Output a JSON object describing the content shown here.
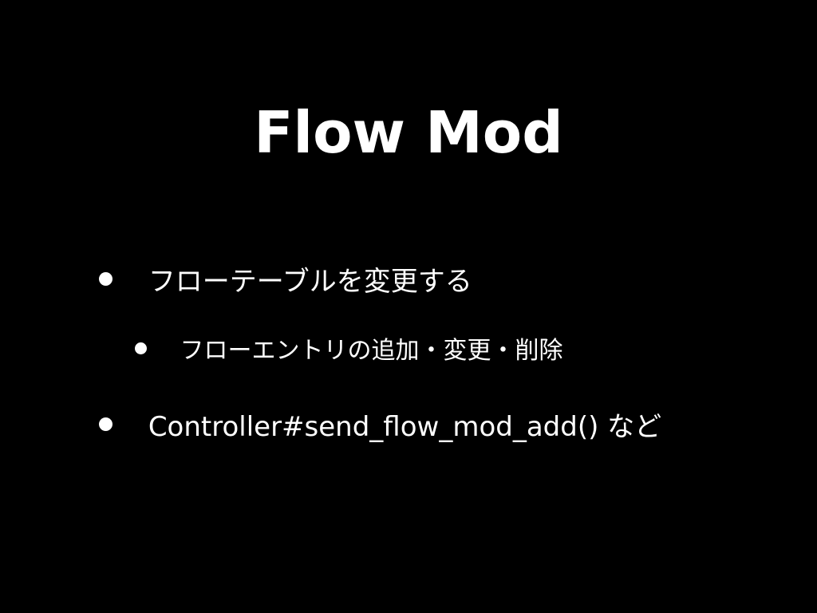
{
  "slide": {
    "title": "Flow Mod",
    "bullets": [
      {
        "level": 1,
        "text": "フローテーブルを変更する"
      },
      {
        "level": 2,
        "text": "フローエントリの追加・変更・削除"
      },
      {
        "level": 1,
        "text": "Controller#send_flow_mod_add() など"
      }
    ]
  }
}
